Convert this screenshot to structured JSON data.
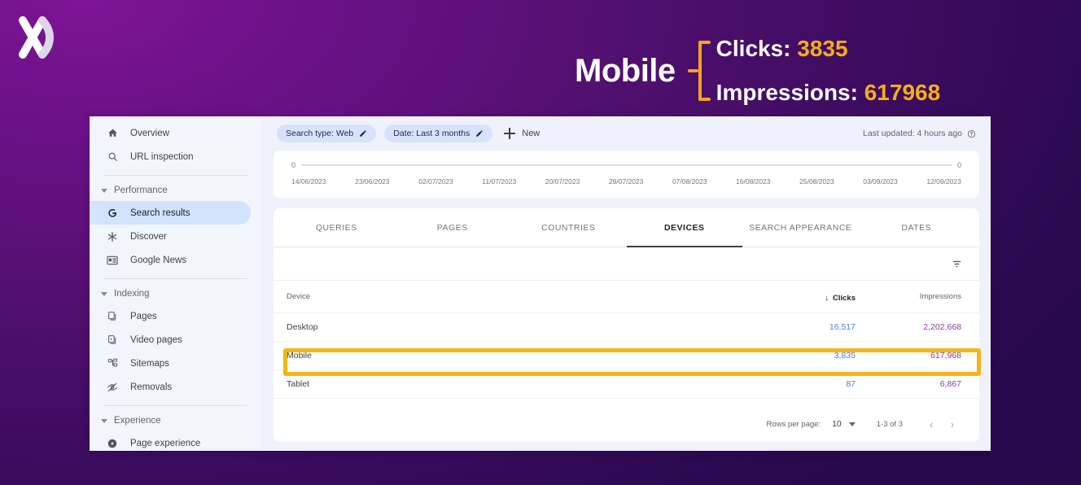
{
  "header": {
    "logo_name": "x-logo",
    "device_label": "Mobile",
    "clicks_label": "Clicks:",
    "clicks_value": "3835",
    "impressions_label": "Impressions:",
    "impressions_value": "617968",
    "accent_color": "#F5AE18",
    "bracket_color": "#F0A61E"
  },
  "sidebar": {
    "items": [
      {
        "label": "Overview",
        "icon": "home-icon"
      },
      {
        "label": "URL inspection",
        "icon": "search-icon"
      }
    ],
    "groups": [
      {
        "label": "Performance",
        "items": [
          {
            "label": "Search results",
            "icon": "google-g-icon",
            "active": true
          },
          {
            "label": "Discover",
            "icon": "asterisk-icon",
            "active": false
          },
          {
            "label": "Google News",
            "icon": "news-card-icon",
            "active": false
          }
        ]
      },
      {
        "label": "Indexing",
        "items": [
          {
            "label": "Pages",
            "icon": "pages-icon",
            "active": false
          },
          {
            "label": "Video pages",
            "icon": "video-pages-icon",
            "active": false
          },
          {
            "label": "Sitemaps",
            "icon": "sitemap-icon",
            "active": false
          },
          {
            "label": "Removals",
            "icon": "eye-off-icon",
            "active": false
          }
        ]
      },
      {
        "label": "Experience",
        "items": [
          {
            "label": "Page experience",
            "icon": "page-experience-icon",
            "active": false
          }
        ]
      }
    ]
  },
  "toolbar": {
    "search_type_chip": "Search type: Web",
    "date_chip": "Date: Last 3 months",
    "new_label": "New",
    "last_updated": "Last updated: 4 hours ago"
  },
  "chart_data": {
    "type": "line",
    "title": "",
    "xlabel": "",
    "ylabel": "",
    "left_axis_zero": "0",
    "right_axis_zero": "0",
    "grid": false,
    "legend_position": "none",
    "categories": [
      "14/06/2023",
      "23/06/2023",
      "02/07/2023",
      "11/07/2023",
      "20/07/2023",
      "29/07/2023",
      "07/08/2023",
      "16/08/2023",
      "25/08/2023",
      "03/09/2023",
      "12/09/2023"
    ],
    "series": [
      {
        "name": "Clicks",
        "values": [
          0,
          0,
          0,
          0,
          0,
          0,
          0,
          0,
          0,
          0,
          0
        ]
      }
    ],
    "ylim": [
      0,
      0
    ]
  },
  "tabs": [
    {
      "label": "QUERIES",
      "active": false
    },
    {
      "label": "PAGES",
      "active": false
    },
    {
      "label": "COUNTRIES",
      "active": false
    },
    {
      "label": "DEVICES",
      "active": true
    },
    {
      "label": "SEARCH APPEARANCE",
      "active": false
    },
    {
      "label": "DATES",
      "active": false
    }
  ],
  "table": {
    "columns": {
      "device": "Device",
      "clicks": "Clicks",
      "impressions": "Impressions"
    },
    "sorted_column": "clicks",
    "sort_arrow": "↓",
    "rows": [
      {
        "device": "Desktop",
        "clicks": "16,517",
        "impressions": "2,202,668",
        "highlighted": false
      },
      {
        "device": "Mobile",
        "clicks": "3,835",
        "impressions": "617,968",
        "highlighted": true
      },
      {
        "device": "Tablet",
        "clicks": "87",
        "impressions": "6,867",
        "highlighted": false
      }
    ],
    "clicks_color": "#4A7FE0",
    "impressions_color": "#8B3D9E",
    "highlight_color": "#F5B418"
  },
  "pagination": {
    "rows_per_page_label": "Rows per page:",
    "rows_per_page_value": "10",
    "range": "1-3 of 3",
    "prev": "‹",
    "next": "›"
  }
}
